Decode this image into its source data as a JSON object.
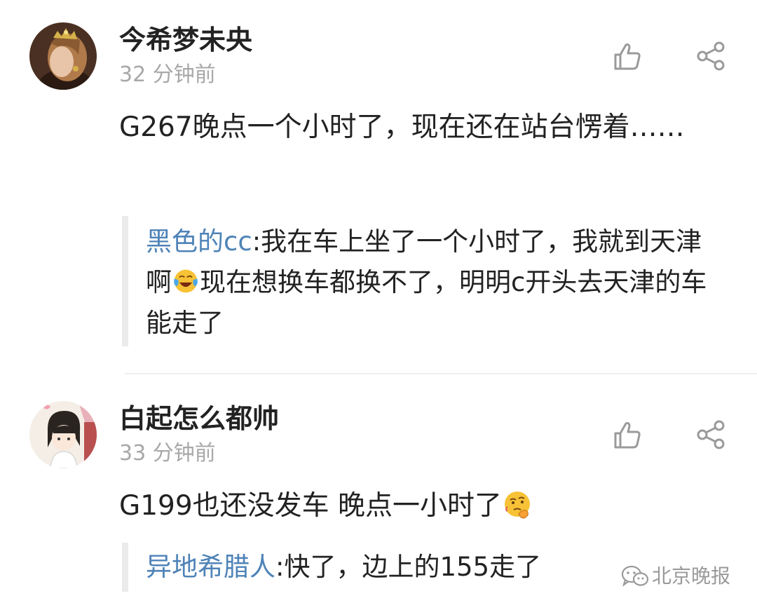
{
  "comments": [
    {
      "username": "今希梦未央",
      "time": "32 分钟前",
      "text": "G267晚点一个小时了，现在还在站台愣着……",
      "reply": {
        "user": "黑色的cc",
        "sep": ":",
        "text_before": "我在车上坐了一个小时了，我就到天津啊",
        "emoji": "crying-laughing-emoji",
        "text_after": "现在想换车都换不了，明明c开头去天津的车能走了"
      }
    },
    {
      "username": "白起怎么都帅",
      "time": "33 分钟前",
      "text": "G199也还没发车 晚点一小时了",
      "emoji": "thinking-emoji",
      "reply": {
        "user": "异地希腊人",
        "sep": ":",
        "text": "快了，边上的155走了"
      }
    }
  ],
  "icons": {
    "like": "thumbs-up-icon",
    "share": "share-icon"
  },
  "watermark": {
    "icon": "wechat-icon",
    "text": "北京晚报"
  },
  "colors": {
    "reply_user": "#4e83b7",
    "time": "#a8a8a8",
    "text": "#222222",
    "reply_bar": "#ebebeb"
  }
}
